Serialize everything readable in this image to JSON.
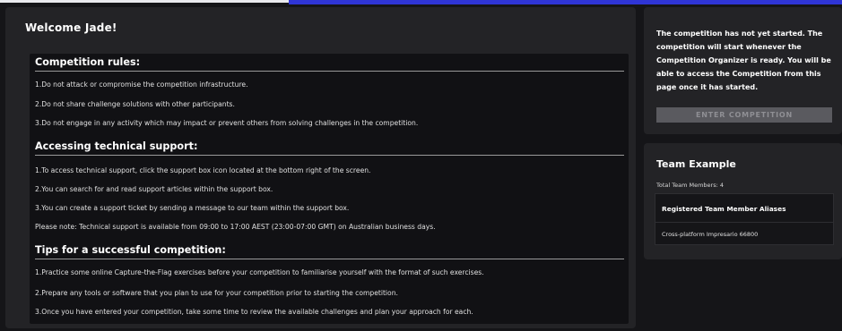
{
  "welcome": "Welcome Jade!",
  "sections": [
    {
      "title": "Competition rules:",
      "items": [
        "1.Do not attack or compromise the competition infrastructure.",
        "2.Do not share challenge solutions with other participants.",
        "3.Do not engage in any activity which may impact or prevent others from solving challenges in the competition."
      ]
    },
    {
      "title": "Accessing technical support:",
      "items": [
        "1.To access technical support, click the support box icon located at the bottom right of the screen.",
        "2.You can search for and read support articles within the support box.",
        "3.You can create a support ticket by sending a message to our team within the support box.",
        "Please note: Technical support is available from 09:00 to 17:00 AEST (23:00-07:00 GMT) on Australian business days."
      ]
    },
    {
      "title": "Tips for a successful competition:",
      "items": [
        "1.Practice some online Capture-the-Flag exercises before your competition to familiarise yourself with the format of such exercises.",
        "2.Prepare any tools or software that you plan to use for your competition prior to starting the competition.",
        "3.Once you have entered your competition, take some time to review the available challenges and plan your approach for each."
      ]
    }
  ],
  "notice": {
    "text": "The competition has not yet started. The competition will start whenever the Competition Organizer is ready. You will be able to access the Competition from this page once it has started.",
    "button": "ENTER COMPETITION"
  },
  "team": {
    "title": "Team Example",
    "count": "Total Team Members: 4",
    "table_header": "Registered Team Member Aliases",
    "members": [
      "Cross-platform Impresario 66800"
    ]
  },
  "colors": {
    "accent": "#2f35d6",
    "card": "#232326",
    "panel": "#111114",
    "disabled_button": "#5a5a5f"
  }
}
